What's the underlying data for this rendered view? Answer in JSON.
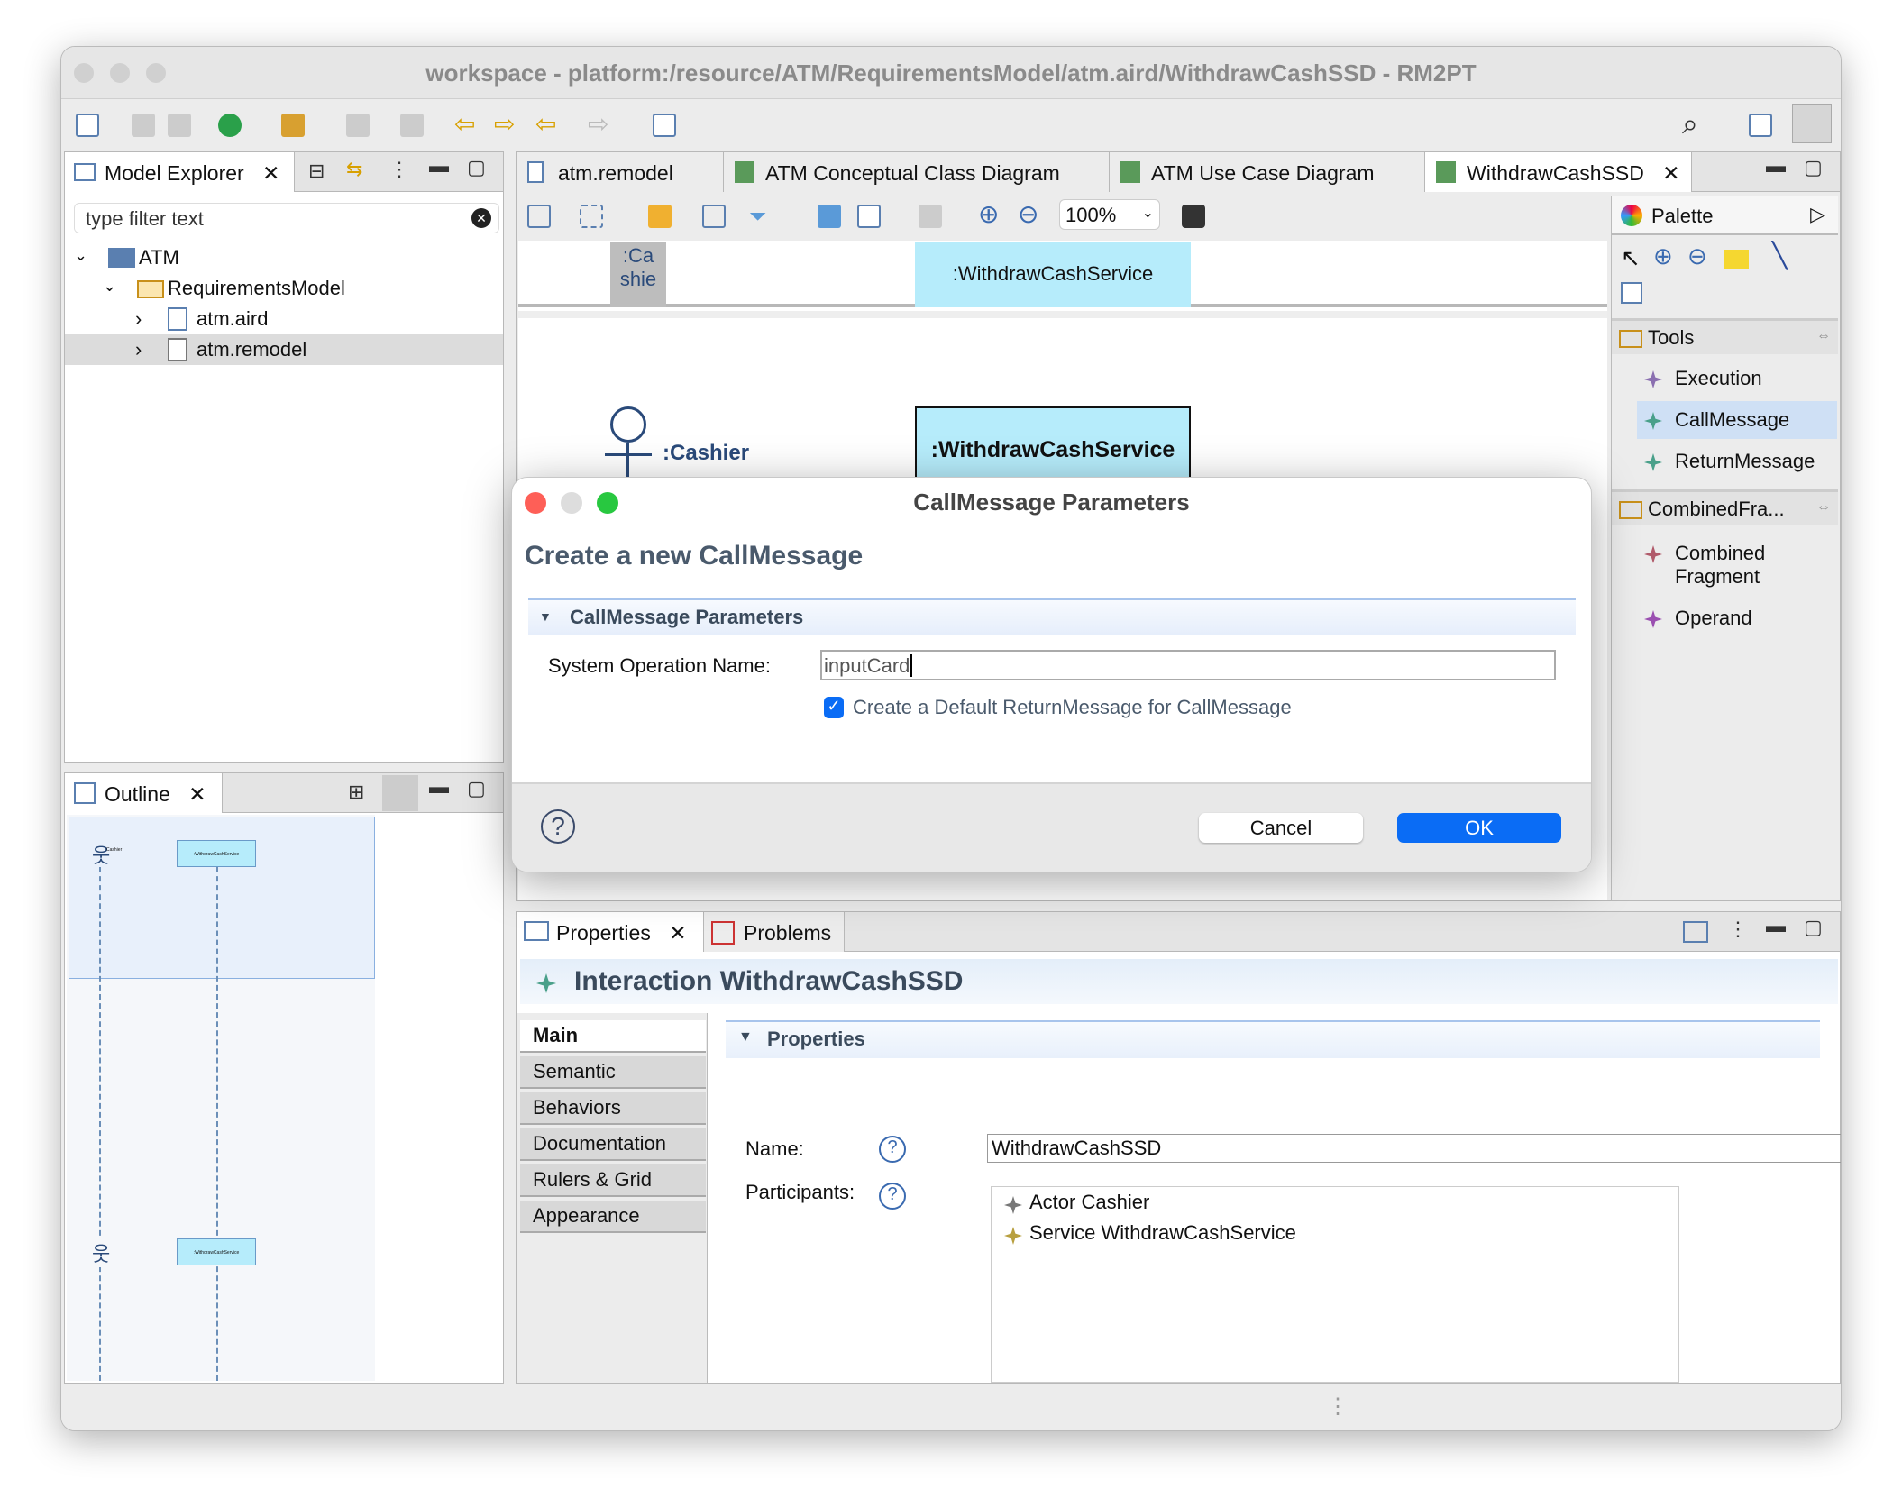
{
  "window": {
    "title": "workspace - platform:/resource/ATM/RequirementsModel/atm.aird/WithdrawCashSSD - RM2PT"
  },
  "toolbar": {
    "icons": [
      "new-icon",
      "save-icon",
      "save-all-icon",
      "run-icon",
      "tool-icon",
      "import-icon",
      "export-icon",
      "back-icon",
      "forward-icon",
      "nav-back-icon",
      "nav-forward-icon",
      "open-icon",
      "search-icon",
      "perspective-icon",
      "modeling-perspective-icon"
    ]
  },
  "explorer": {
    "title": "Model Explorer",
    "filter_placeholder": "type filter text",
    "tree": [
      {
        "label": "ATM",
        "level": 0,
        "expanded": true
      },
      {
        "label": "RequirementsModel",
        "level": 1,
        "expanded": true
      },
      {
        "label": "atm.aird",
        "level": 2,
        "expanded": false
      },
      {
        "label": "atm.remodel",
        "level": 2,
        "expanded": false,
        "selected": true
      }
    ]
  },
  "outline": {
    "title": "Outline",
    "mini_labels": {
      "actor": "Cashier",
      "service": ":WithdrawCashService"
    }
  },
  "editor": {
    "tabs": [
      {
        "label": "atm.remodel"
      },
      {
        "label": "ATM Conceptual Class Diagram"
      },
      {
        "label": "ATM Use Case Diagram"
      },
      {
        "label": "WithdrawCashSSD",
        "active": true
      }
    ],
    "zoom": "100%",
    "diagram": {
      "header_actor": ":Ca shie",
      "header_service": ":WithdrawCashService",
      "actor": ":Cashier",
      "service": ":WithdrawCashService"
    }
  },
  "palette": {
    "title": "Palette",
    "groups": [
      {
        "label": "Tools",
        "items": [
          {
            "label": "Execution",
            "color": "#8a6fb0"
          },
          {
            "label": "CallMessage",
            "color": "#4aa08a",
            "selected": true
          },
          {
            "label": "ReturnMessage",
            "color": "#4aa08a"
          }
        ]
      },
      {
        "label": "CombinedFra...",
        "items": [
          {
            "label": "Combined Fragment",
            "color": "#b05a6a"
          },
          {
            "label": "Operand",
            "color": "#9a4fb0"
          }
        ]
      }
    ]
  },
  "dialog": {
    "title": "CallMessage Parameters",
    "heading": "Create a new CallMessage",
    "section": "CallMessage Parameters",
    "field_label": "System Operation Name:",
    "field_value": "inputCard",
    "checkbox_label": "Create a Default ReturnMessage for CallMessage",
    "checkbox_checked": true,
    "cancel": "Cancel",
    "ok": "OK",
    "accent": "#0a6cf5"
  },
  "properties": {
    "tabs": [
      {
        "label": "Properties",
        "active": true
      },
      {
        "label": "Problems"
      }
    ],
    "header": "Interaction WithdrawCashSSD",
    "side_tabs": [
      "Main",
      "Semantic",
      "Behaviors",
      "Documentation",
      "Rulers & Grid",
      "Appearance"
    ],
    "section": "Properties",
    "name_label": "Name:",
    "name_value": "WithdrawCashSSD",
    "participants_label": "Participants:",
    "participants": [
      "Actor Cashier",
      "Service WithdrawCashService"
    ],
    "buttons": [
      "...",
      "add",
      "remove",
      "up",
      "down"
    ]
  }
}
